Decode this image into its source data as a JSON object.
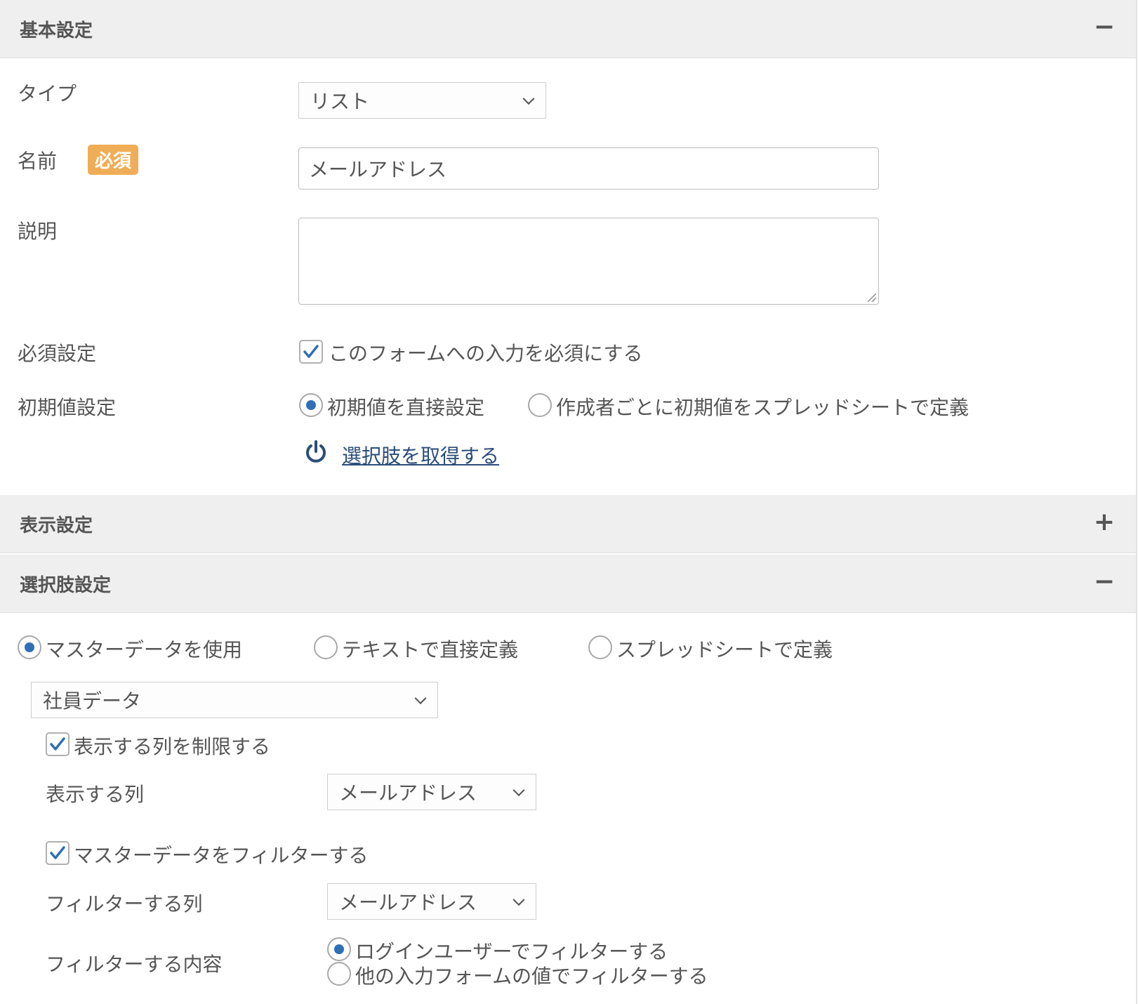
{
  "basic_settings": {
    "title": "基本設定",
    "toggle": "−",
    "type": {
      "label": "タイプ",
      "value": "リスト"
    },
    "name": {
      "label": "名前",
      "badge": "必須",
      "value": "メールアドレス"
    },
    "description": {
      "label": "説明",
      "value": ""
    },
    "required": {
      "label": "必須設定",
      "checkbox_label": "このフォームへの入力を必須にする",
      "checked": true
    },
    "initial_value": {
      "label": "初期値設定",
      "options": [
        {
          "label": "初期値を直接設定",
          "selected": true
        },
        {
          "label": "作成者ごとに初期値をスプレッドシートで定義",
          "selected": false
        }
      ]
    },
    "fetch_link": "選択肢を取得する"
  },
  "display_settings": {
    "title": "表示設定",
    "toggle": "+"
  },
  "choice_settings": {
    "title": "選択肢設定",
    "toggle": "−",
    "source_options": [
      {
        "label": "マスターデータを使用",
        "selected": true
      },
      {
        "label": "テキストで直接定義",
        "selected": false
      },
      {
        "label": "スプレッドシートで定義",
        "selected": false
      }
    ],
    "master_select": "社員データ",
    "limit_columns": {
      "label": "表示する列を制限する",
      "checked": true
    },
    "display_column": {
      "label": "表示する列",
      "value": "メールアドレス"
    },
    "filter_master": {
      "label": "マスターデータをフィルターする",
      "checked": true
    },
    "filter_column": {
      "label": "フィルターする列",
      "value": "メールアドレス"
    },
    "filter_content": {
      "label": "フィルターする内容",
      "options": [
        {
          "label": "ログインユーザーでフィルターする",
          "selected": true
        },
        {
          "label": "他の入力フォームの値でフィルターする",
          "selected": false
        }
      ]
    }
  },
  "colors": {
    "accent": "#2f6fb5",
    "badge": "#f0ad57",
    "header_bg": "#efefef",
    "link": "#2a4d7a"
  }
}
